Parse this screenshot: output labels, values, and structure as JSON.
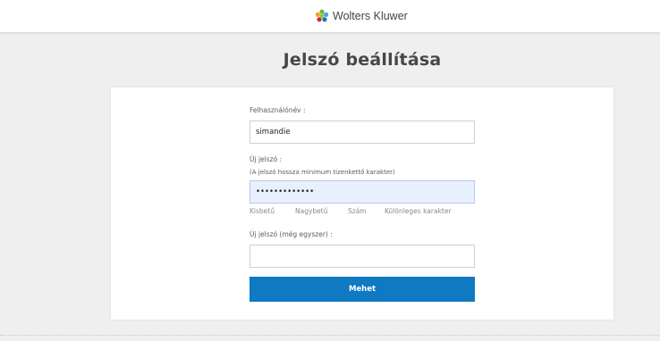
{
  "header": {
    "brand_name": "Wolters Kluwer",
    "logo_icon": "wolters-kluwer-logo-icon",
    "bg_color": "#ffffff"
  },
  "page": {
    "title": "Jelszó beállítása",
    "bg_color": "#efefef"
  },
  "form": {
    "username": {
      "label": "Felhasználónév :",
      "value": "simandie"
    },
    "new_password": {
      "label": "Új jelszó :",
      "hint": "(A jelszó hossza minimum tizenkettő karakter)",
      "value": "•••••••••••••"
    },
    "strength_rules": [
      "Kisbetű",
      "Nagybetű",
      "Szám",
      "Különleges karakter"
    ],
    "confirm_password": {
      "label": "Új jelszó (még egyszer) :",
      "value": ""
    },
    "submit_label": "Mehet",
    "accent_color": "#0f79c2"
  }
}
